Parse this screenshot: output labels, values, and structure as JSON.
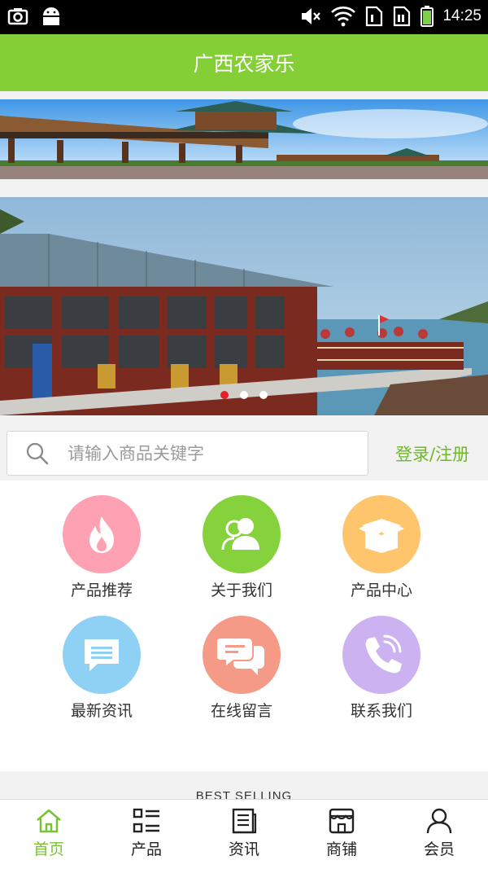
{
  "status_bar": {
    "time": "14:25",
    "left_icons": [
      "screenshot-icon",
      "android-icon"
    ],
    "right_icons": [
      "mute-icon",
      "wifi-icon",
      "sim1-icon",
      "sim2-icon",
      "battery-icon"
    ]
  },
  "app": {
    "title": "广西农家乐",
    "accent_color": "#85cf36"
  },
  "carousel": {
    "slide_count": 3,
    "active_index": 0
  },
  "search": {
    "placeholder": "请输入商品关键字",
    "login_label": "登录/注册"
  },
  "menu": {
    "items": [
      {
        "label": "产品推荐",
        "icon": "fire-icon",
        "color": "#fda1b3"
      },
      {
        "label": "关于我们",
        "icon": "users-icon",
        "color": "#86d23c"
      },
      {
        "label": "产品中心",
        "icon": "box-icon",
        "color": "#fec56c"
      },
      {
        "label": "最新资讯",
        "icon": "message-icon",
        "color": "#8fd1f5"
      },
      {
        "label": "在线留言",
        "icon": "chat-icon",
        "color": "#f59a86"
      },
      {
        "label": "联系我们",
        "icon": "phone-icon",
        "color": "#cdb2f2"
      }
    ]
  },
  "section": {
    "best_selling": "BEST SELLING"
  },
  "bottom_nav": {
    "items": [
      {
        "label": "首页",
        "icon": "home-icon",
        "active": true
      },
      {
        "label": "产品",
        "icon": "list-icon",
        "active": false
      },
      {
        "label": "资讯",
        "icon": "news-icon",
        "active": false
      },
      {
        "label": "商铺",
        "icon": "shop-icon",
        "active": false
      },
      {
        "label": "会员",
        "icon": "user-icon",
        "active": false
      }
    ]
  }
}
